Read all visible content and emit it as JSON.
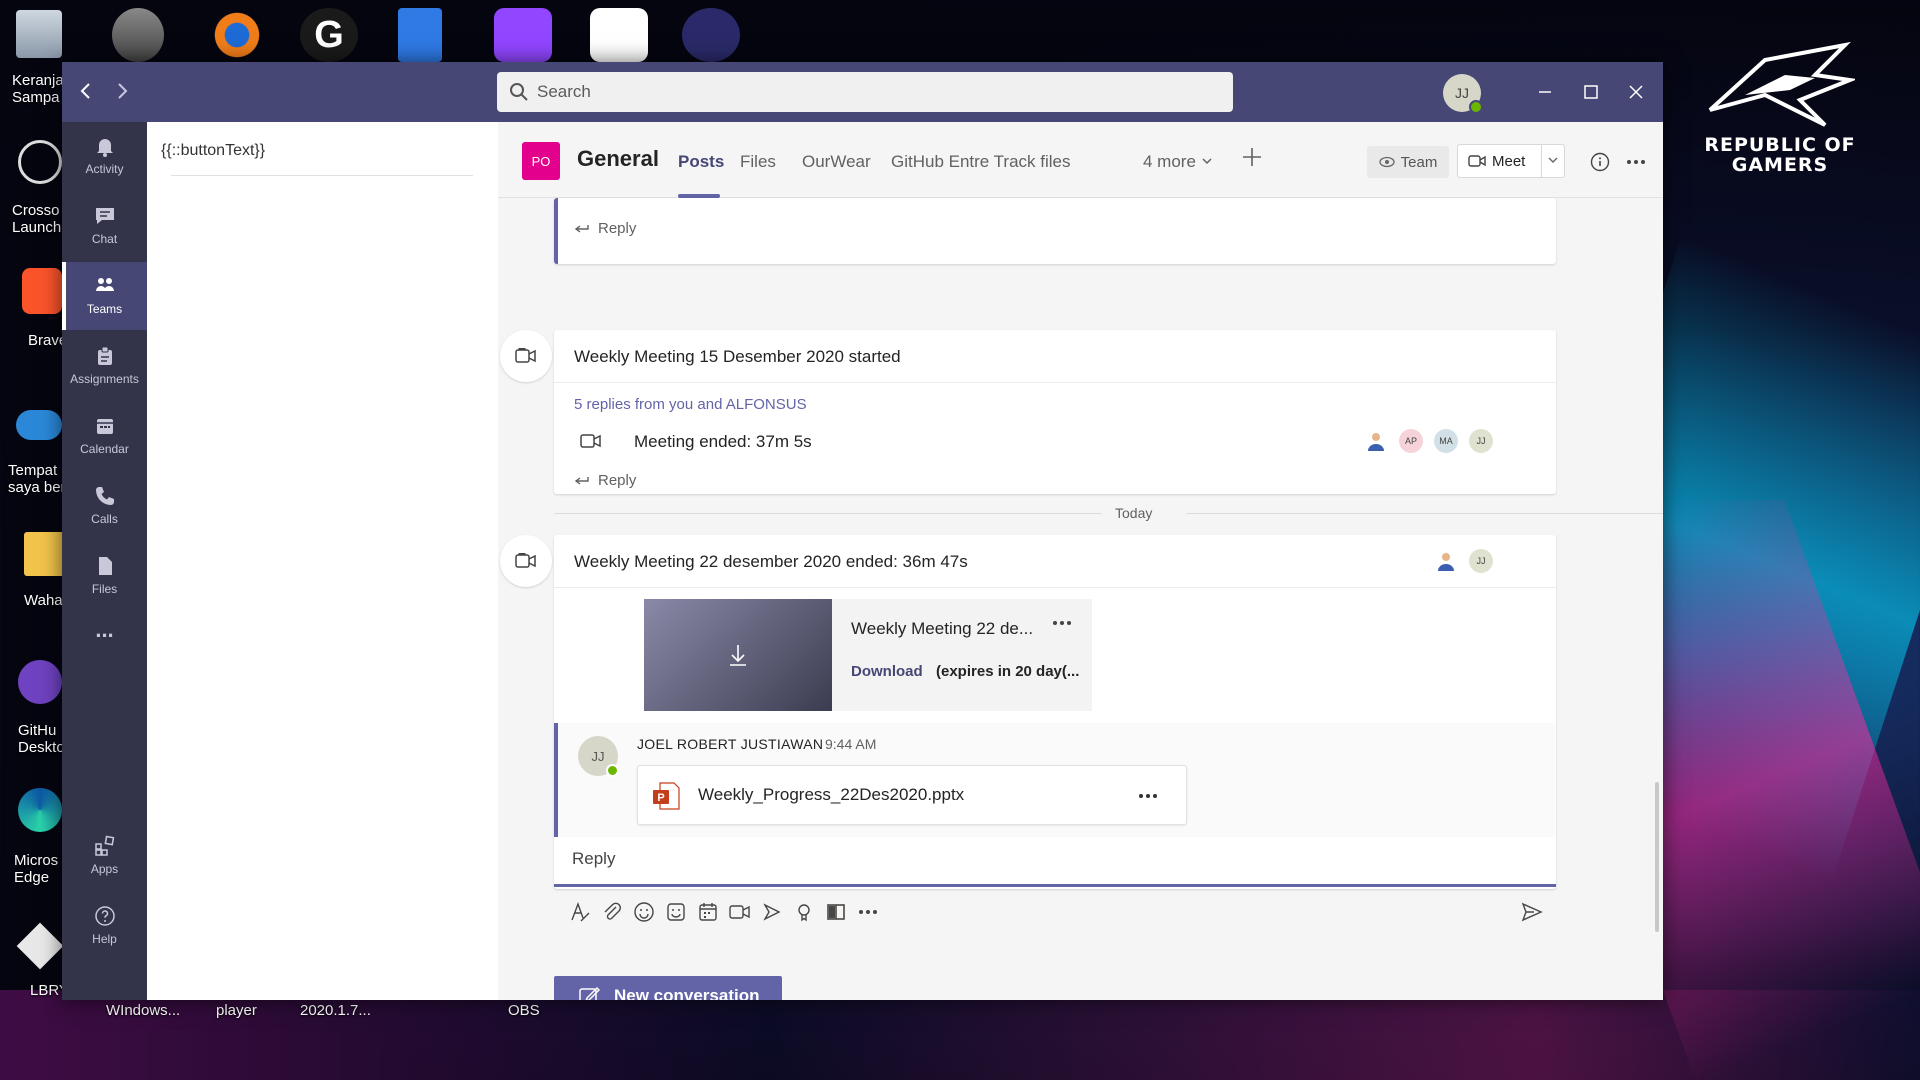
{
  "desktop": {
    "icons": [
      {
        "label_l1": "Keranja",
        "label_l2": "Sampa"
      },
      {
        "label_l1": "Crosso",
        "label_l2": "Launche"
      },
      {
        "label_l1": "Brave",
        "label_l2": ""
      },
      {
        "label_l1": "Tempat",
        "label_l2": "saya ber"
      },
      {
        "label_l1": "Waha",
        "label_l2": ""
      },
      {
        "label_l1": "GitHu",
        "label_l2": "Deskto"
      },
      {
        "label_l1": "Micros",
        "label_l2": "Edge"
      },
      {
        "label_l1": "LBRY",
        "label_l2": ""
      }
    ],
    "taskbar_labels": [
      "WIndows...",
      "player",
      "2020.1.7...",
      "OBS"
    ],
    "rog_text_l1": "REPUBLIC OF",
    "rog_text_l2": "GAMERS"
  },
  "titlebar": {
    "search_placeholder": "Search",
    "avatar_initials": "JJ"
  },
  "rail": {
    "items": [
      {
        "label": "Activity",
        "icon": "bell-icon"
      },
      {
        "label": "Chat",
        "icon": "chat-icon"
      },
      {
        "label": "Teams",
        "icon": "teams-icon",
        "active": true
      },
      {
        "label": "Assignments",
        "icon": "assignments-icon"
      },
      {
        "label": "Calendar",
        "icon": "calendar-icon"
      },
      {
        "label": "Calls",
        "icon": "phone-icon"
      },
      {
        "label": "Files",
        "icon": "file-icon"
      }
    ],
    "more": "...",
    "apps_label": "Apps",
    "help_label": "Help"
  },
  "channel_panel": {
    "button_text": "{{::buttonText}}"
  },
  "channel_header": {
    "team_initials": "PO",
    "channel_name": "General",
    "tabs": [
      "Posts",
      "Files",
      "OurWear",
      "GitHub Entre Track files",
      "4 more"
    ],
    "team_button": "Team",
    "meet_button": "Meet"
  },
  "feed": {
    "prev_reply": "Reply",
    "meeting1": {
      "title": "Weekly Meeting 15 Desember 2020 started",
      "replies": "5 replies from you and ALFONSUS",
      "ended": "Meeting ended: 37m 5s",
      "participants": [
        "AP",
        "MA",
        "JJ"
      ],
      "reply": "Reply"
    },
    "divider": "Today",
    "meeting2": {
      "title": "Weekly Meeting 22 desember 2020 ended: 36m 47s",
      "participants": [
        "JJ"
      ],
      "recording": {
        "title": "Weekly Meeting 22 de...",
        "download": "Download",
        "expires": "(expires in 20 day(..."
      },
      "reply_author": "JOEL ROBERT JUSTIAWAN",
      "reply_time": "9:44 AM",
      "reply_avatar": "JJ",
      "attachment": "Weekly_Progress_22Des2020.pptx",
      "reply_placeholder": "Reply"
    },
    "new_conversation": "New conversation"
  },
  "colors": {
    "teams_purple": "#464775",
    "accent": "#6264a7",
    "team_tile": "#e3008c",
    "presence": "#6bb700"
  }
}
